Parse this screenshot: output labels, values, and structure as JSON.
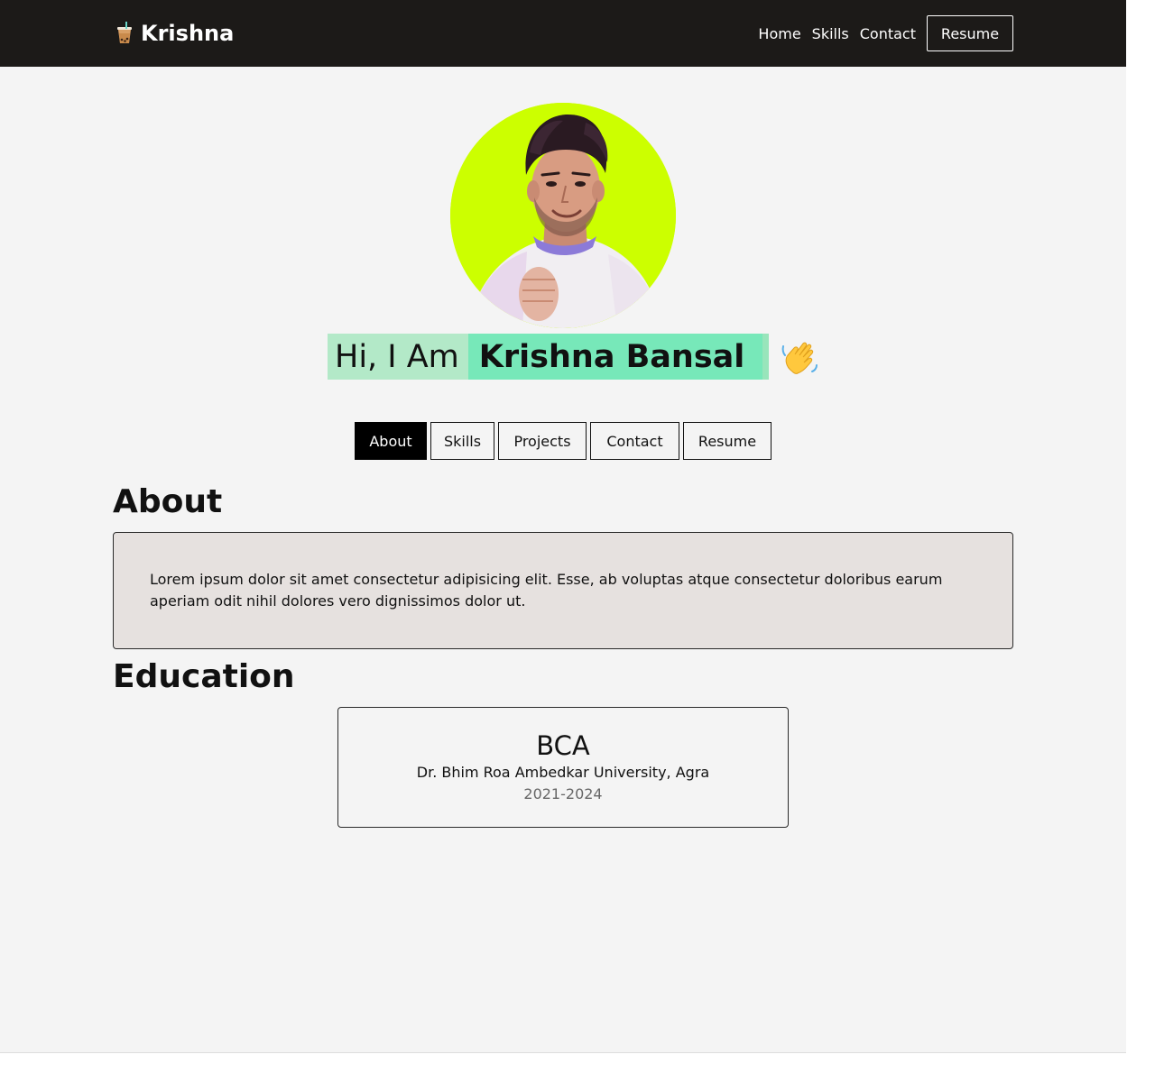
{
  "navbar": {
    "brand": "Krishna",
    "brand_icon": "bubble-tea-icon",
    "links": [
      "Home",
      "Skills",
      "Contact"
    ],
    "resume_label": "Resume"
  },
  "hero": {
    "avatar_alt": "profile-photo",
    "greeting": "Hi, I Am",
    "name": "Krishna Bansal",
    "wave_icon": "waving-hand-icon"
  },
  "tabs": [
    {
      "label": "About",
      "active": true
    },
    {
      "label": "Skills",
      "active": false
    },
    {
      "label": "Projects",
      "active": false
    },
    {
      "label": "Contact",
      "active": false
    },
    {
      "label": "Resume",
      "active": false
    }
  ],
  "about": {
    "title": "About",
    "text": "Lorem ipsum dolor sit amet consectetur adipisicing elit. Esse, ab voluptas atque consectetur doloribus earum aperiam odit nihil dolores vero dignissimos dolor ut."
  },
  "education": {
    "title": "Education",
    "items": [
      {
        "degree": "BCA",
        "university": "Dr. Bhim Roa Ambedkar University, Agra",
        "years": "2021-2024"
      }
    ]
  },
  "colors": {
    "navbar_bg": "#1c1a18",
    "page_bg": "#f4f4f4",
    "avatar_bg": "#ccff00",
    "greeting_bg": "#b3e9c8",
    "name_bg": "#77e8b9",
    "about_box_bg": "#e6e1df",
    "active_tab_bg": "#000000"
  }
}
